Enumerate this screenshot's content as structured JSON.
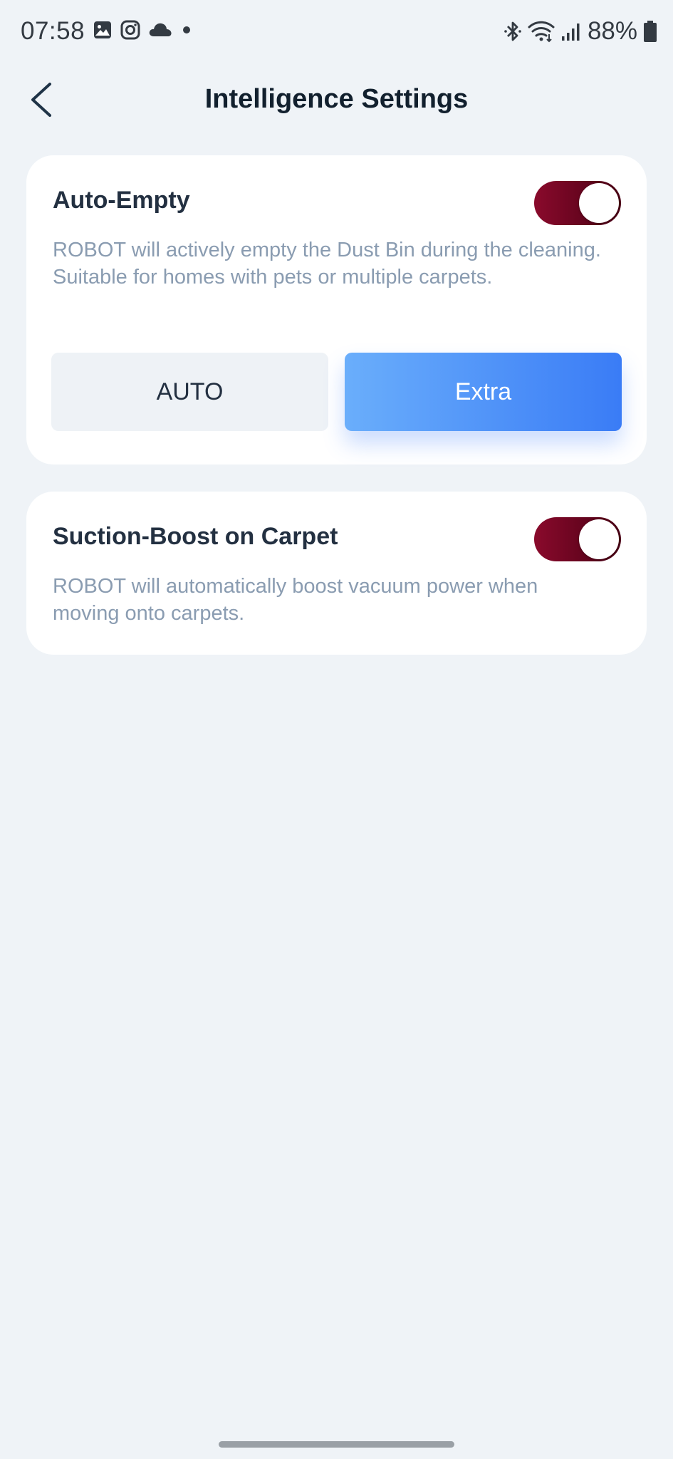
{
  "status_bar": {
    "time": "07:58",
    "battery": "88%",
    "left_icons": [
      "gallery-icon",
      "instagram-icon",
      "cloud-icon",
      "dot-icon"
    ],
    "right_icons": [
      "bluetooth-icon",
      "wifi-icon",
      "signal-icon",
      "battery-icon"
    ]
  },
  "header": {
    "title": "Intelligence Settings",
    "back_icon": "chevron-left-icon"
  },
  "auto_empty": {
    "title": "Auto-Empty",
    "description": "ROBOT will actively empty the Dust Bin during the cleaning. Suitable for homes with pets or multiple carpets.",
    "enabled": true,
    "modes": [
      {
        "label": "AUTO",
        "selected": false
      },
      {
        "label": "Extra",
        "selected": true
      }
    ]
  },
  "suction_boost": {
    "title": "Suction-Boost on Carpet",
    "description": "ROBOT will automatically boost vacuum power when moving onto carpets.",
    "enabled": true
  },
  "colors": {
    "background": "#eff3f7",
    "toggle_on": "#7a0a28",
    "accent_blue": "#3a7cf6",
    "description_text": "#8a9cb1"
  }
}
